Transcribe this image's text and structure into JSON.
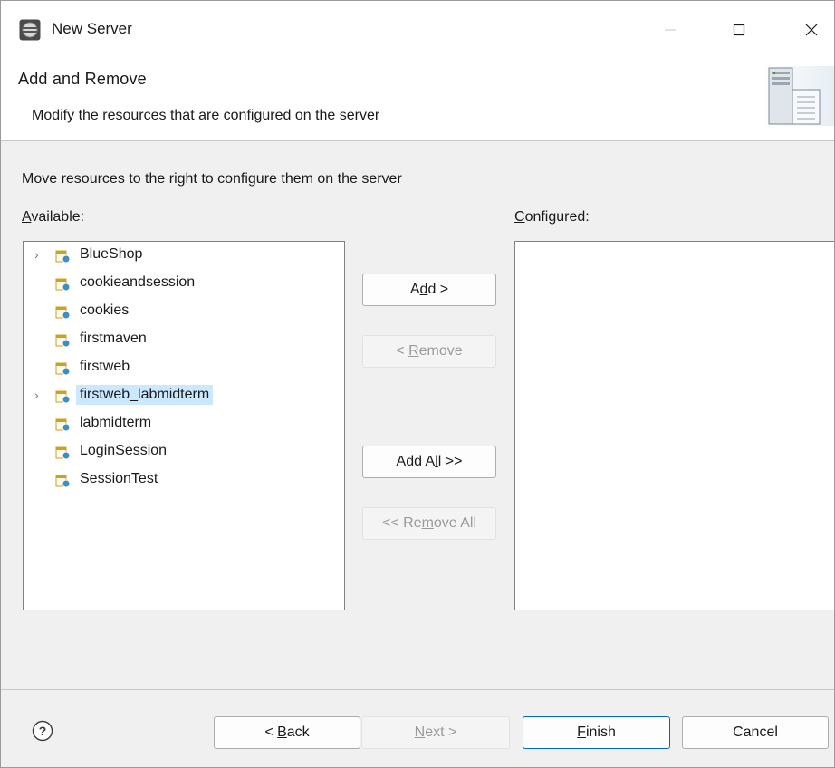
{
  "window": {
    "title": "New Server"
  },
  "titlebar_buttons": {
    "minimize": "—",
    "maximize": "☐",
    "close": "✕"
  },
  "banner": {
    "title": "Add and Remove",
    "description": "Modify the resources that are configured on the server"
  },
  "instruction": "Move resources to the right to configure them on the server",
  "available": {
    "label_mnemonic": "A",
    "label_rest": "vailable:",
    "items": [
      {
        "label": "BlueShop",
        "expandable": true,
        "selected": false
      },
      {
        "label": "cookieandsession",
        "expandable": false,
        "selected": false
      },
      {
        "label": "cookies",
        "expandable": false,
        "selected": false
      },
      {
        "label": "firstmaven",
        "expandable": false,
        "selected": false
      },
      {
        "label": "firstweb",
        "expandable": false,
        "selected": false
      },
      {
        "label": "firstweb_labmidterm",
        "expandable": true,
        "selected": true
      },
      {
        "label": "labmidterm",
        "expandable": false,
        "selected": false
      },
      {
        "label": "LoginSession",
        "expandable": false,
        "selected": false
      },
      {
        "label": "SessionTest",
        "expandable": false,
        "selected": false
      }
    ]
  },
  "configured": {
    "label_mnemonic": "C",
    "label_rest": "onfigured:",
    "items": []
  },
  "buttons": {
    "add": {
      "pre": "A",
      "mn": "d",
      "post": "d >"
    },
    "remove": {
      "pre": "< ",
      "mn": "R",
      "post": "emove"
    },
    "add_all": {
      "pre": "Add A",
      "mn": "l",
      "post": "l >>"
    },
    "remove_all": {
      "pre": "<< Re",
      "mn": "m",
      "post": "ove All"
    },
    "back": {
      "pre": "< ",
      "mn": "B",
      "post": "ack"
    },
    "next": {
      "pre": "",
      "mn": "N",
      "post": "ext >"
    },
    "finish": {
      "pre": "",
      "mn": "F",
      "post": "inish"
    },
    "cancel": "Cancel"
  },
  "help_icon": "question-mark-icon",
  "colors": {
    "selection": "#cce8ff",
    "default_button_border": "#0067c0"
  }
}
